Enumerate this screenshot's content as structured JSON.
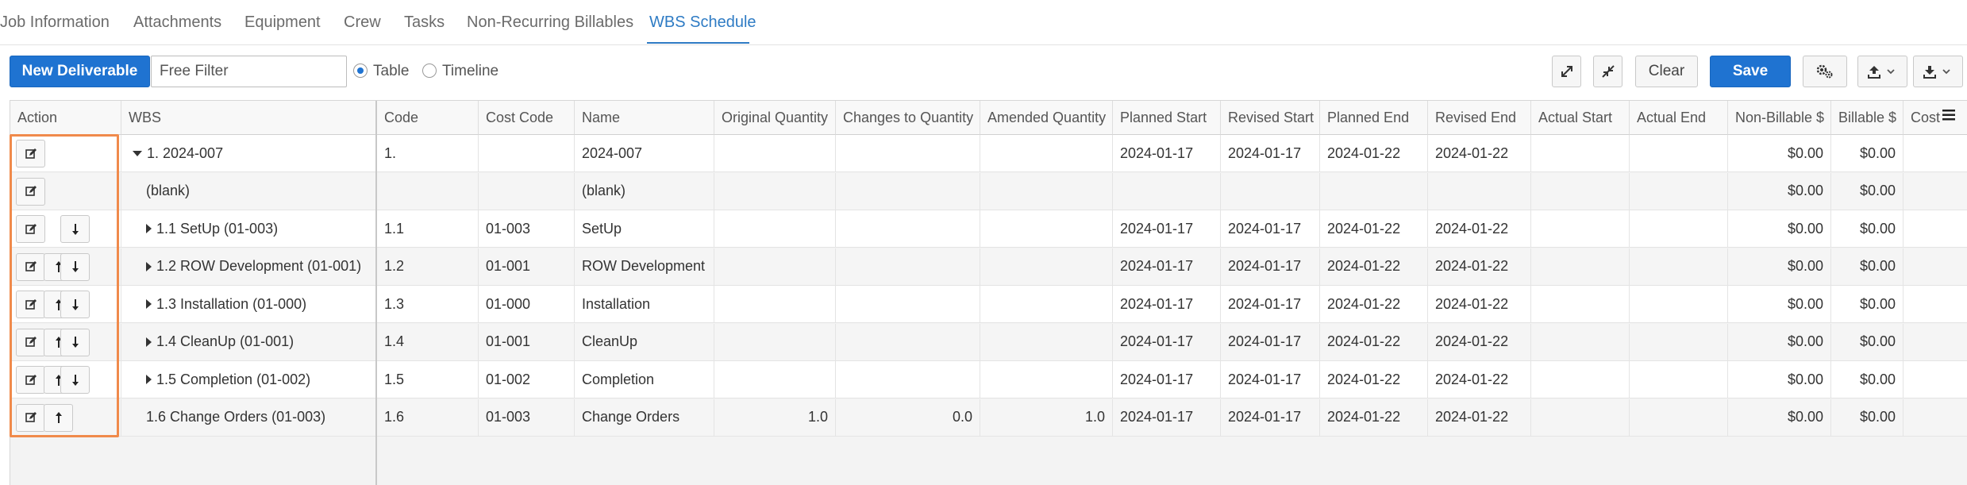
{
  "tabs": [
    {
      "label": "Job Information",
      "active": false
    },
    {
      "label": "Attachments",
      "active": false
    },
    {
      "label": "Equipment",
      "active": false
    },
    {
      "label": "Crew",
      "active": false
    },
    {
      "label": "Tasks",
      "active": false
    },
    {
      "label": "Non-Recurring Billables",
      "active": false
    },
    {
      "label": "WBS Schedule",
      "active": true
    }
  ],
  "toolbar": {
    "new_deliverable": "New Deliverable",
    "filter_placeholder": "Free Filter",
    "filter_value": "",
    "view_options": [
      "Table",
      "Timeline"
    ],
    "selected_view": "Table",
    "clear": "Clear",
    "save": "Save",
    "icons": [
      "expand-icon",
      "collapse-icon",
      "settings-icon",
      "upload-icon",
      "download-icon"
    ]
  },
  "grid": {
    "columns": [
      "Action",
      "WBS",
      "Code",
      "Cost Code",
      "Name",
      "Original Quantity",
      "Changes to Quantity",
      "Amended Quantity",
      "Planned Start",
      "Revised Start",
      "Planned End",
      "Revised End",
      "Actual Start",
      "Actual End",
      "Non-Billable $",
      "Billable $",
      "Cost"
    ],
    "rows": [
      {
        "actions": [
          "edit"
        ],
        "expander": "down",
        "wbs": "1. 2024-007",
        "code": "1.",
        "cost_code": "",
        "name": "2024-007",
        "orig_qty": "",
        "chg_qty": "",
        "amend_qty": "",
        "planned_start": "2024-01-17",
        "revised_start": "2024-01-17",
        "planned_end": "2024-01-22",
        "revised_end": "2024-01-22",
        "actual_start": "",
        "actual_end": "",
        "non_billable": "$0.00",
        "billable": "$0.00"
      },
      {
        "actions": [
          "edit"
        ],
        "expander": "none",
        "wbs": "(blank)",
        "code": "",
        "cost_code": "",
        "name": "(blank)",
        "orig_qty": "",
        "chg_qty": "",
        "amend_qty": "",
        "planned_start": "",
        "revised_start": "",
        "planned_end": "",
        "revised_end": "",
        "actual_start": "",
        "actual_end": "",
        "non_billable": "$0.00",
        "billable": "$0.00"
      },
      {
        "actions": [
          "edit",
          "down"
        ],
        "expander": "right",
        "wbs": "1.1 SetUp (01-003)",
        "code": "1.1",
        "cost_code": "01-003",
        "name": "SetUp",
        "orig_qty": "",
        "chg_qty": "",
        "amend_qty": "",
        "planned_start": "2024-01-17",
        "revised_start": "2024-01-17",
        "planned_end": "2024-01-22",
        "revised_end": "2024-01-22",
        "actual_start": "",
        "actual_end": "",
        "non_billable": "$0.00",
        "billable": "$0.00"
      },
      {
        "actions": [
          "edit",
          "up",
          "down"
        ],
        "expander": "right",
        "wbs": "1.2 ROW Development (01-001)",
        "code": "1.2",
        "cost_code": "01-001",
        "name": "ROW Development",
        "orig_qty": "",
        "chg_qty": "",
        "amend_qty": "",
        "planned_start": "2024-01-17",
        "revised_start": "2024-01-17",
        "planned_end": "2024-01-22",
        "revised_end": "2024-01-22",
        "actual_start": "",
        "actual_end": "",
        "non_billable": "$0.00",
        "billable": "$0.00"
      },
      {
        "actions": [
          "edit",
          "up",
          "down"
        ],
        "expander": "right",
        "wbs": "1.3 Installation (01-000)",
        "code": "1.3",
        "cost_code": "01-000",
        "name": "Installation",
        "orig_qty": "",
        "chg_qty": "",
        "amend_qty": "",
        "planned_start": "2024-01-17",
        "revised_start": "2024-01-17",
        "planned_end": "2024-01-22",
        "revised_end": "2024-01-22",
        "actual_start": "",
        "actual_end": "",
        "non_billable": "$0.00",
        "billable": "$0.00"
      },
      {
        "actions": [
          "edit",
          "up",
          "down"
        ],
        "expander": "right",
        "wbs": "1.4 CleanUp (01-001)",
        "code": "1.4",
        "cost_code": "01-001",
        "name": "CleanUp",
        "orig_qty": "",
        "chg_qty": "",
        "amend_qty": "",
        "planned_start": "2024-01-17",
        "revised_start": "2024-01-17",
        "planned_end": "2024-01-22",
        "revised_end": "2024-01-22",
        "actual_start": "",
        "actual_end": "",
        "non_billable": "$0.00",
        "billable": "$0.00"
      },
      {
        "actions": [
          "edit",
          "up",
          "down"
        ],
        "expander": "right",
        "wbs": "1.5 Completion (01-002)",
        "code": "1.5",
        "cost_code": "01-002",
        "name": "Completion",
        "orig_qty": "",
        "chg_qty": "",
        "amend_qty": "",
        "planned_start": "2024-01-17",
        "revised_start": "2024-01-17",
        "planned_end": "2024-01-22",
        "revised_end": "2024-01-22",
        "actual_start": "",
        "actual_end": "",
        "non_billable": "$0.00",
        "billable": "$0.00"
      },
      {
        "actions": [
          "edit",
          "up"
        ],
        "expander": "none",
        "wbs": "1.6 Change Orders (01-003)",
        "code": "1.6",
        "cost_code": "01-003",
        "name": "Change Orders",
        "orig_qty": "1.0",
        "chg_qty": "0.0",
        "amend_qty": "1.0",
        "planned_start": "2024-01-17",
        "revised_start": "2024-01-17",
        "planned_end": "2024-01-22",
        "revised_end": "2024-01-22",
        "actual_start": "",
        "actual_end": "",
        "non_billable": "$0.00",
        "billable": "$0.00"
      }
    ]
  },
  "colors": {
    "accent": "#1f73d1",
    "tab_active": "#2e7bc4",
    "highlight": "#f08a4b"
  }
}
